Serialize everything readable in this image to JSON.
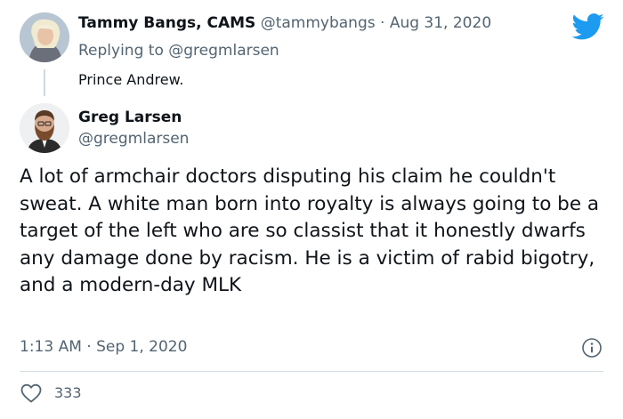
{
  "reply_tweet": {
    "author_name": "Tammy Bangs, CAMS",
    "author_handle": "@tammybangs",
    "separator": "·",
    "date": "Aug 31, 2020",
    "replying_prefix": "Replying to",
    "replying_handle": "@gregmlarsen",
    "text": "Prince Andrew."
  },
  "main_tweet": {
    "author_name": "Greg Larsen",
    "author_handle": "@gregmlarsen",
    "text": "A lot of armchair doctors disputing his claim he couldn't sweat. A white man born into royalty is always going to be a target of the left who are so classist that it honestly dwarfs any damage done by racism. He is a victim of rabid bigotry, and a modern-day MLK",
    "time": "1:13 AM",
    "separator": "·",
    "date": "Sep 1, 2020",
    "like_count": "333"
  },
  "icons": {
    "logo": "twitter-bird-icon",
    "info": "info-icon",
    "like": "heart-icon"
  },
  "colors": {
    "twitter_blue": "#1d9bf0",
    "text_primary": "#0f1419",
    "text_muted": "#536471"
  }
}
